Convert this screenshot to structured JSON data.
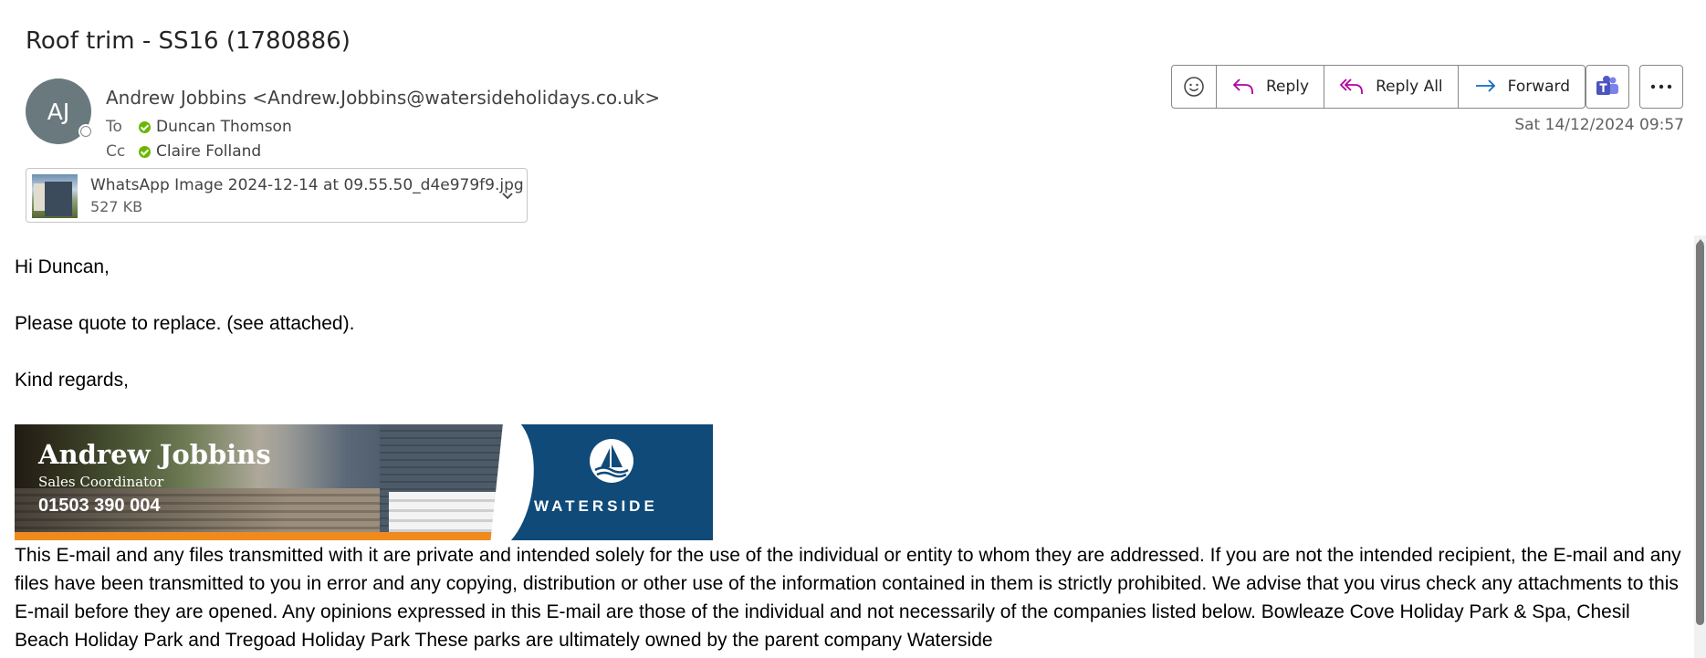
{
  "subject": "Roof trim - SS16 (1780886)",
  "sender": {
    "initials": "AJ",
    "display": "Andrew Jobbins <Andrew.Jobbins@watersideholidays.co.uk>"
  },
  "recipients": {
    "to_label": "To",
    "to": "Duncan Thomson",
    "cc_label": "Cc",
    "cc": "Claire Folland"
  },
  "attachment": {
    "name": "WhatsApp Image 2024-12-14 at 09.55.50_d4e979f9.jpg",
    "size": "527 KB"
  },
  "toolbar": {
    "reply": "Reply",
    "reply_all": "Reply All",
    "forward": "Forward"
  },
  "date": "Sat 14/12/2024 09:57",
  "body": {
    "greeting": "Hi Duncan,",
    "line1": "Please quote to replace. (see attached).",
    "signoff": "Kind regards,"
  },
  "signature": {
    "name": "Andrew Jobbins",
    "role": "Sales Coordinator",
    "phone": "01503 390 004",
    "brand": "WATERSIDE"
  },
  "disclaimer": "This E-mail and any files transmitted with it are private and intended solely for the use of the individual or entity to whom they are addressed. If you are not the intended recipient, the E-mail and any files have been transmitted to you in error and any copying, distribution or other use of the information contained in them is strictly prohibited. We advise that you virus check any attachments to this E-mail before they are opened. Any opinions expressed in this E-mail are those of the individual and not necessarily of the companies listed below. Bowleaze Cove Holiday Park & Spa, Chesil Beach Holiday Park and Tregoad Holiday Park These parks are ultimately owned by the parent company Waterside",
  "colors": {
    "avatar": "#69797e",
    "presence_ok": "#6bb700",
    "reply_icon": "#b4009e",
    "forward_icon": "#0f6cbd",
    "banner_blue": "#0f4a79",
    "banner_orange": "#ef8a1d"
  },
  "icons": {
    "emoji": "smiley-icon",
    "reply": "reply-arrow-icon",
    "reply_all": "reply-all-arrow-icon",
    "forward": "forward-arrow-icon",
    "teams": "teams-icon",
    "more": "more-icon"
  }
}
